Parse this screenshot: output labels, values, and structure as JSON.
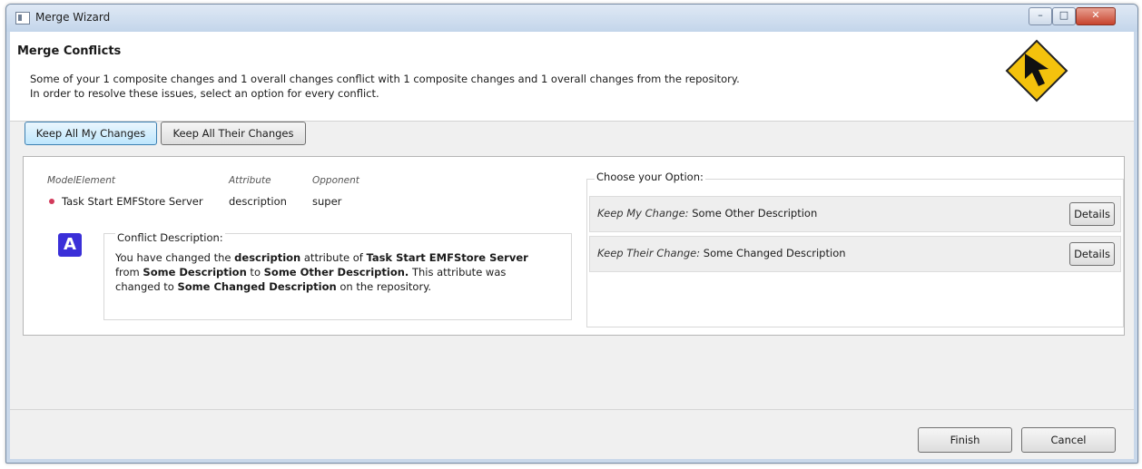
{
  "window": {
    "title": "Merge Wizard",
    "min": "–",
    "max": "□",
    "close": "✕"
  },
  "header": {
    "title": "Merge Conflicts",
    "line1": "Some of your 1 composite changes and 1 overall changes conflict with 1 composite changes and 1 overall changes from the repository.",
    "line2": "In order to resolve these issues, select an option for every conflict."
  },
  "toolbar": {
    "keep_mine": "Keep All My Changes",
    "keep_theirs": "Keep All Their Changes"
  },
  "conflict": {
    "col_model": "ModelElement",
    "col_attribute": "Attribute",
    "col_opponent": "Opponent",
    "element": "Task Start EMFStore Server",
    "attribute": "description",
    "opponent": "super",
    "desc_title": "Conflict Description:",
    "d1": "You have changed the ",
    "d2": "description",
    "d3": " attribute of ",
    "d4": "Task Start EMFStore Server",
    "d5": "from ",
    "d6": "Some Description",
    "d7": " to ",
    "d8": "Some Other Description.",
    "d9": " This attribute was",
    "d10": "changed to ",
    "d11": "Some Changed Description",
    "d12": " on the repository."
  },
  "options": {
    "title": "Choose your Option:",
    "mine_label": "Keep My Change:",
    "mine_value": "Some Other Description",
    "theirs_label": "Keep Their Change:",
    "theirs_value": "Some Changed Description",
    "details": "Details"
  },
  "footer": {
    "finish": "Finish",
    "cancel": "Cancel"
  },
  "icon": {
    "conflict_glyph": "A"
  },
  "colors": {
    "logo_yellow": "#f4c20d",
    "conflict_icon": "#3a2fd8",
    "bullet": "#d23a5b"
  }
}
